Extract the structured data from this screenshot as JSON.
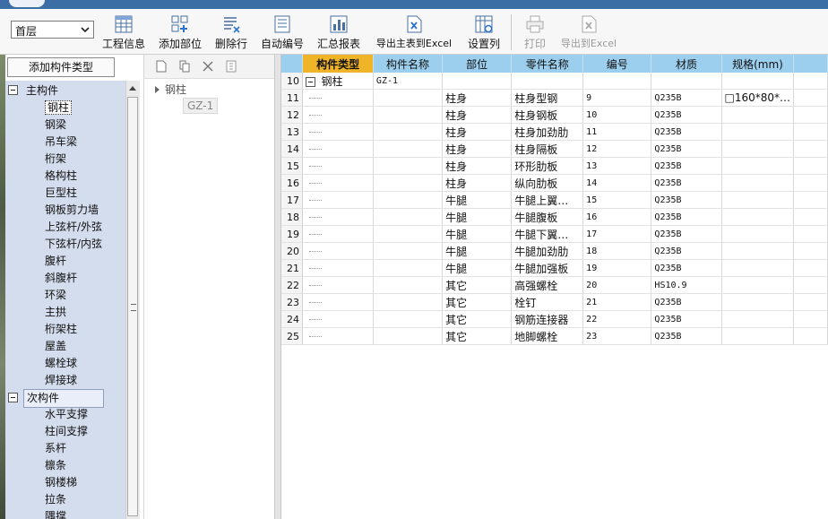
{
  "toolbar": {
    "floor": "首层",
    "buttons": [
      {
        "label": "工程信息",
        "icon": "table-icon"
      },
      {
        "label": "添加部位",
        "icon": "add-part-icon"
      },
      {
        "label": "删除行",
        "icon": "delete-row-icon"
      },
      {
        "label": "自动编号",
        "icon": "auto-number-icon"
      },
      {
        "label": "汇总报表",
        "icon": "report-chart-icon"
      },
      {
        "label": "导出主表到Excel",
        "icon": "excel-export-icon"
      },
      {
        "label": "设置列",
        "icon": "column-settings-icon"
      },
      {
        "label": "打印",
        "icon": "printer-icon"
      },
      {
        "label": "导出到Excel",
        "icon": "excel-export-icon"
      }
    ]
  },
  "left": {
    "add_button": "添加构件类型",
    "categories": [
      {
        "label": "主构件",
        "children": [
          "钢柱",
          "钢梁",
          "吊车梁",
          "桁架",
          "格构柱",
          "巨型柱",
          "钢板剪力墙",
          "上弦杆/外弦",
          "下弦杆/内弦",
          "腹杆",
          "斜腹杆",
          "环梁",
          "主拱",
          "桁架柱",
          "屋盖",
          "螺栓球",
          "焊接球"
        ]
      },
      {
        "label": "次构件",
        "children": [
          "水平支撑",
          "柱间支撑",
          "系杆",
          "檩条",
          "钢楼梯",
          "拉条",
          "隅撑"
        ]
      }
    ]
  },
  "mid": {
    "root": "钢柱",
    "leaf": "GZ-1"
  },
  "grid": {
    "columns": [
      "构件类型",
      "构件名称",
      "部位",
      "零件名称",
      "编号",
      "材质",
      "规格(mm)"
    ],
    "rows": [
      {
        "n": "10",
        "type": "钢柱",
        "name": "GZ-1",
        "part": "",
        "piece": "",
        "code": "",
        "mat": "",
        "spec": ""
      },
      {
        "n": "11",
        "type": "",
        "name": "",
        "part": "柱身",
        "piece": "柱身型钢",
        "code": "9",
        "mat": "Q235B",
        "spec": "□160*80*…"
      },
      {
        "n": "12",
        "type": "",
        "name": "",
        "part": "柱身",
        "piece": "柱身钢板",
        "code": "10",
        "mat": "Q235B",
        "spec": ""
      },
      {
        "n": "13",
        "type": "",
        "name": "",
        "part": "柱身",
        "piece": "柱身加劲肋",
        "code": "11",
        "mat": "Q235B",
        "spec": ""
      },
      {
        "n": "14",
        "type": "",
        "name": "",
        "part": "柱身",
        "piece": "柱身隔板",
        "code": "12",
        "mat": "Q235B",
        "spec": ""
      },
      {
        "n": "15",
        "type": "",
        "name": "",
        "part": "柱身",
        "piece": "环形肋板",
        "code": "13",
        "mat": "Q235B",
        "spec": ""
      },
      {
        "n": "16",
        "type": "",
        "name": "",
        "part": "柱身",
        "piece": "纵向肋板",
        "code": "14",
        "mat": "Q235B",
        "spec": ""
      },
      {
        "n": "17",
        "type": "",
        "name": "",
        "part": "牛腿",
        "piece": "牛腿上翼…",
        "code": "15",
        "mat": "Q235B",
        "spec": ""
      },
      {
        "n": "18",
        "type": "",
        "name": "",
        "part": "牛腿",
        "piece": "牛腿腹板",
        "code": "16",
        "mat": "Q235B",
        "spec": ""
      },
      {
        "n": "19",
        "type": "",
        "name": "",
        "part": "牛腿",
        "piece": "牛腿下翼…",
        "code": "17",
        "mat": "Q235B",
        "spec": ""
      },
      {
        "n": "20",
        "type": "",
        "name": "",
        "part": "牛腿",
        "piece": "牛腿加劲肋",
        "code": "18",
        "mat": "Q235B",
        "spec": ""
      },
      {
        "n": "21",
        "type": "",
        "name": "",
        "part": "牛腿",
        "piece": "牛腿加强板",
        "code": "19",
        "mat": "Q235B",
        "spec": ""
      },
      {
        "n": "22",
        "type": "",
        "name": "",
        "part": "其它",
        "piece": "高强螺栓",
        "code": "20",
        "mat": "HS10.9",
        "spec": ""
      },
      {
        "n": "23",
        "type": "",
        "name": "",
        "part": "其它",
        "piece": "栓钉",
        "code": "21",
        "mat": "Q235B",
        "spec": ""
      },
      {
        "n": "24",
        "type": "",
        "name": "",
        "part": "其它",
        "piece": "钢筋连接器",
        "code": "22",
        "mat": "Q235B",
        "spec": ""
      },
      {
        "n": "25",
        "type": "",
        "name": "",
        "part": "其它",
        "piece": "地脚螺栓",
        "code": "23",
        "mat": "Q235B",
        "spec": ""
      }
    ]
  }
}
